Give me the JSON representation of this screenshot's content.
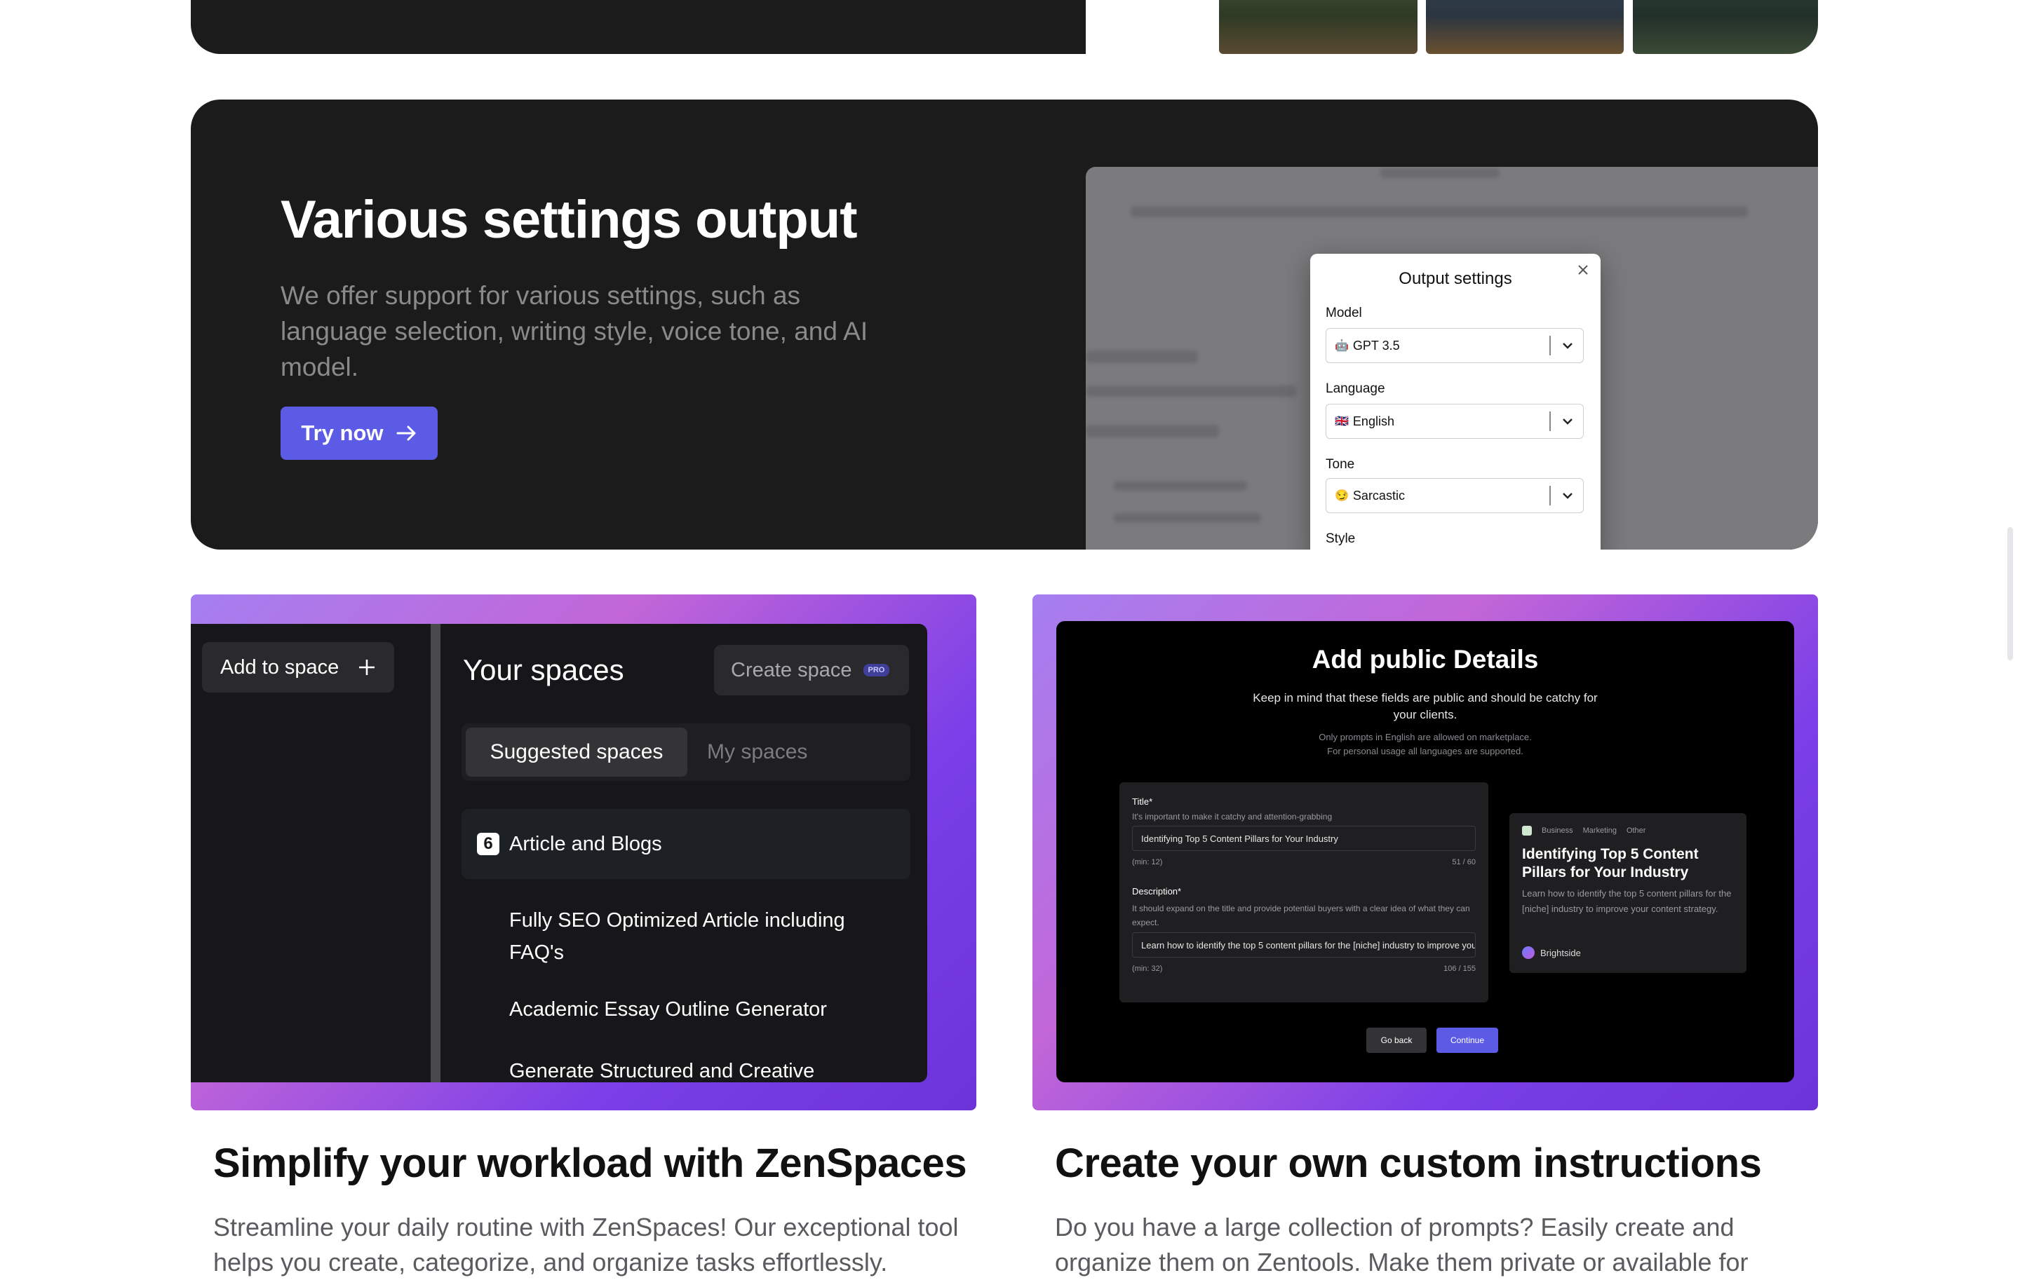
{
  "settings_card": {
    "title": "Various settings output",
    "description": "We offer support for various settings, such as language selection, writing style, voice tone, and AI model.",
    "button_label": "Try now",
    "modal": {
      "title": "Output settings",
      "fields": [
        {
          "label": "Model",
          "value": "GPT 3.5",
          "icon": "🤖"
        },
        {
          "label": "Language",
          "value": "English",
          "icon": "🇬🇧"
        },
        {
          "label": "Tone",
          "value": "Sarcastic",
          "icon": "😏"
        }
      ],
      "style_label": "Style"
    }
  },
  "zenspaces_card": {
    "add_to_space": "Add to space",
    "panel_title": "Your spaces",
    "create_space": "Create space",
    "pro_badge": "PRO",
    "tabs": [
      "Suggested spaces",
      "My spaces"
    ],
    "space_icon_num": "6",
    "space_name": "Article and Blogs",
    "items": [
      "Fully SEO Optimized Article including FAQ's",
      "Academic Essay Outline Generator",
      "Generate Structured and Creative"
    ],
    "heading": "Simplify your workload with ZenSpaces",
    "text": "Streamline your daily routine with ZenSpaces! Our exceptional tool helps you create, categorize, and organize tasks effortlessly."
  },
  "public_card": {
    "title": "Add public Details",
    "subtitle": "Keep in mind that these fields are public and should be catchy for your clients.",
    "note1": "Only prompts in English are allowed on marketplace.",
    "note2": "For personal usage all languages are supported.",
    "form": {
      "title_label": "Title*",
      "title_hint": "It's important to make it catchy and attention-grabbing",
      "title_value": "Identifying Top 5 Content Pillars for Your Industry",
      "title_min": "(min: 12)",
      "title_count": "51 / 60",
      "desc_label": "Description*",
      "desc_hint": "It should expand on the title and provide potential buyers with a clear idea of what they can expect.",
      "desc_value": "Learn how to identify the top 5 content pillars for the [niche] industry to improve your content strategy.",
      "desc_min": "(min: 32)",
      "desc_count": "106 / 155"
    },
    "preview": {
      "tags": [
        "Business",
        "Marketing",
        "Other"
      ],
      "title": "Identifying Top 5 Content Pillars for Your Industry",
      "desc": "Learn how to identify the top 5 content pillars for the [niche] industry to improve your content strategy.",
      "author": "Brightside"
    },
    "back_button": "Go back",
    "continue_button": "Continue",
    "heading": "Create your own custom instructions",
    "text": "Do you have a large collection of prompts? Easily create and organize them on Zentools. Make them private or available for"
  },
  "colors": {
    "accent": "#5b5be6",
    "dark_card": "#1b1b1c"
  }
}
